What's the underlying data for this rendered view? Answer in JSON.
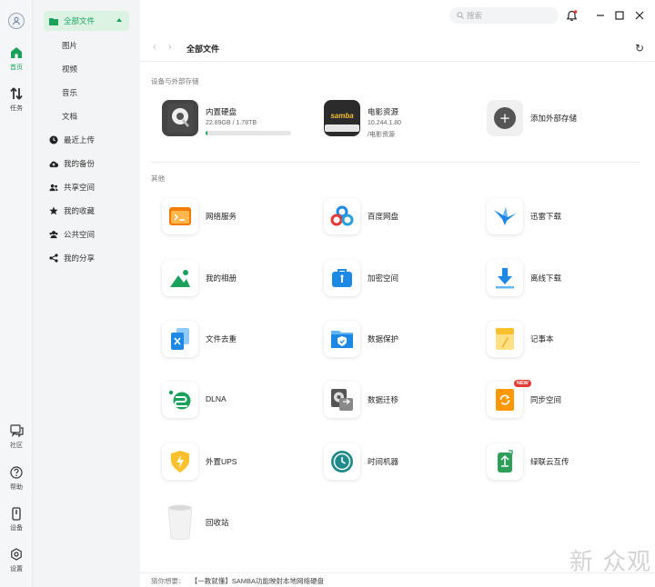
{
  "rail": {
    "items": [
      {
        "label": "首页",
        "active": true
      },
      {
        "label": "任务"
      },
      {
        "label": "社区"
      },
      {
        "label": "帮助"
      },
      {
        "label": "设备"
      },
      {
        "label": "设置"
      }
    ]
  },
  "sidebar": {
    "all_files": "全部文件",
    "subs": [
      "图片",
      "视频",
      "音乐",
      "文档"
    ],
    "items": [
      "最近上传",
      "我的备份",
      "共享空间",
      "我的收藏",
      "公共空间",
      "我的分享"
    ]
  },
  "top": {
    "search_placeholder": "搜索"
  },
  "nav": {
    "back": "‹",
    "forward": "›",
    "title": "全部文件",
    "refresh": "↻"
  },
  "devices": {
    "section": "设备与外部存储",
    "internal": {
      "label": "内置硬盘",
      "usage": "22.89GB / 1.78TB",
      "progress": 0.013
    },
    "movie": {
      "label": "电影资源",
      "ip": "10.244.1.80",
      "path": "/电影资源",
      "logo": "samba"
    },
    "add": {
      "label": "添加外部存储",
      "icon": "+"
    }
  },
  "other": {
    "section": "其他",
    "tiles": [
      {
        "label": "网络服务"
      },
      {
        "label": "百度网盘"
      },
      {
        "label": "迅雷下载"
      },
      {
        "label": "我的相册"
      },
      {
        "label": "加密空间"
      },
      {
        "label": "离线下载"
      },
      {
        "label": "文件去重"
      },
      {
        "label": "数据保护"
      },
      {
        "label": "记事本"
      },
      {
        "label": "DLNA"
      },
      {
        "label": "数据迁移"
      },
      {
        "label": "同步空间",
        "badge": "NEW"
      },
      {
        "label": "外置UPS"
      },
      {
        "label": "时间机器"
      },
      {
        "label": "绿联云互传"
      },
      {
        "label": "回收站"
      }
    ]
  },
  "footer": {
    "hint": "猜你想要：",
    "link": "【一教就懂】SAMBA功能映射本地网络硬盘"
  },
  "watermark": "新 众观",
  "colors": {
    "accent": "#1aa25c",
    "badge": "#e53935"
  }
}
